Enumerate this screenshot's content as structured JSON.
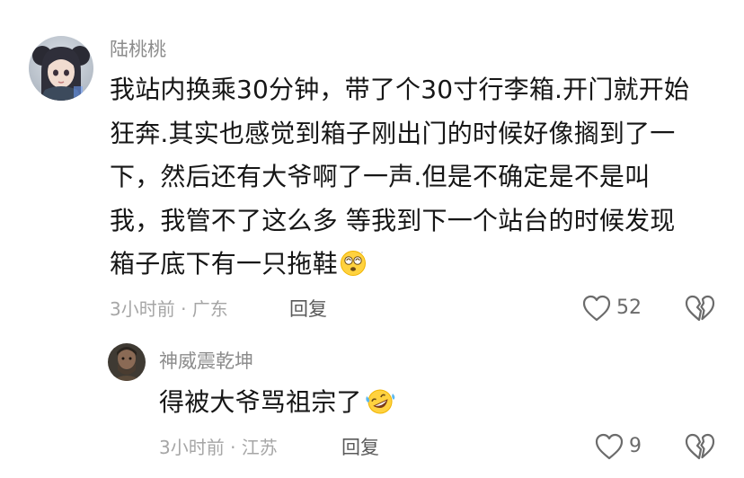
{
  "comments": [
    {
      "user": "陆桃桃",
      "lines": [
        "我站内换乘30分钟，带了个30寸行李箱.开门就开始",
        "狂奔.其实也感觉到箱子刚出门的时候好像搁到了一",
        "下，然后还有大爷啊了一声.但是不确定是不是叫",
        "我，我管不了这么多 等我到下一个站台的时候发现",
        "箱子底下有一只拖鞋"
      ],
      "emoji": "dizzy-face-emoji",
      "meta": "3小时前 · 广东",
      "reply_label": "回复",
      "like_count": "52",
      "icons": {
        "like": "heart-outline-icon",
        "dislike": "broken-heart-outline-icon"
      }
    },
    {
      "user": "神威震乾坤",
      "lines": [
        "得被大爷骂祖宗了"
      ],
      "emoji": "rolling-laughing-emoji",
      "meta": "3小时前 · 江苏",
      "reply_label": "回复",
      "like_count": "9",
      "icons": {
        "like": "heart-outline-icon",
        "dislike": "broken-heart-outline-icon"
      }
    }
  ],
  "colors": {
    "text": "#161616",
    "secondary": "#8c8c8c",
    "meta": "#a6a6a6",
    "icon": "#6b6b6b"
  }
}
